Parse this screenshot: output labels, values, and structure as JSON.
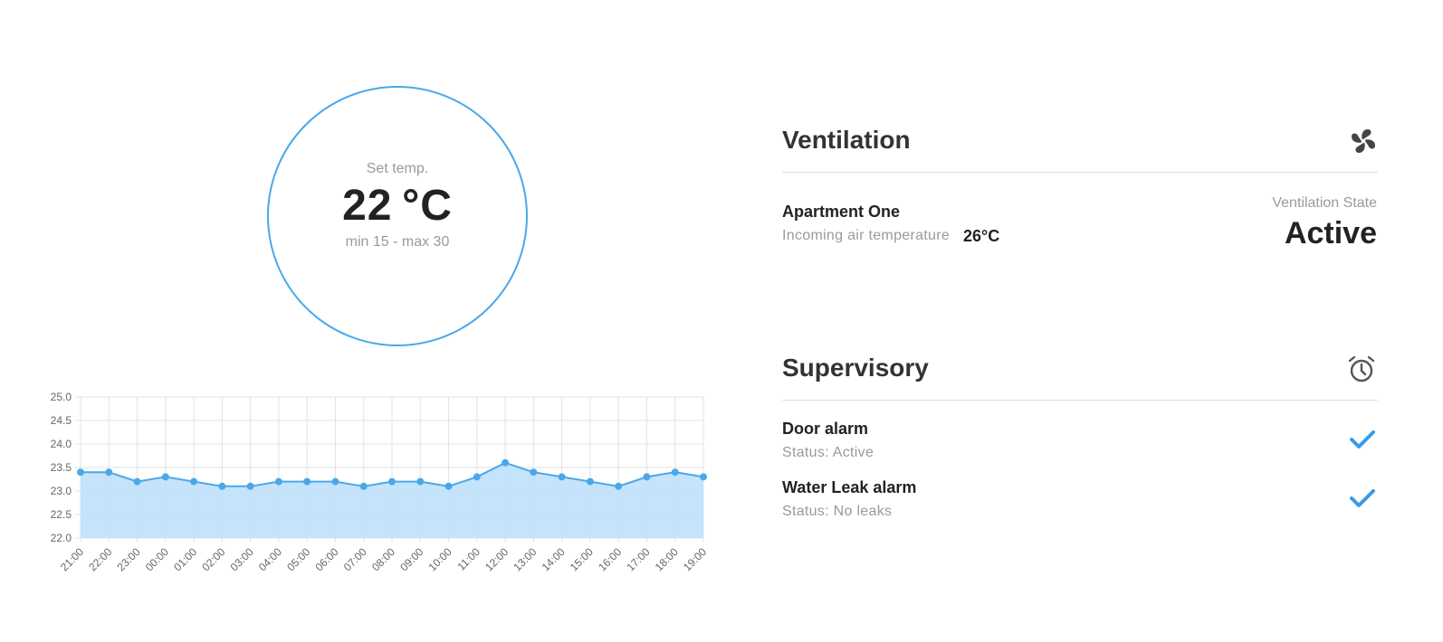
{
  "thermostat": {
    "label": "Set temp.",
    "value": "22 °C",
    "range": "min 15 - max 30",
    "accent": "#4aa8ea"
  },
  "chart_data": {
    "type": "area",
    "categories": [
      "21:00",
      "22:00",
      "23:00",
      "00:00",
      "01:00",
      "02:00",
      "03:00",
      "04:00",
      "05:00",
      "06:00",
      "07:00",
      "08:00",
      "09:00",
      "10:00",
      "11:00",
      "12:00",
      "13:00",
      "14:00",
      "15:00",
      "16:00",
      "17:00",
      "18:00",
      "19:00"
    ],
    "values": [
      23.4,
      23.4,
      23.2,
      23.3,
      23.2,
      23.1,
      23.1,
      23.2,
      23.2,
      23.2,
      23.1,
      23.2,
      23.2,
      23.1,
      23.3,
      23.6,
      23.4,
      23.3,
      23.2,
      23.1,
      23.3,
      23.4,
      23.3
    ],
    "ylim": [
      22.0,
      25.0
    ],
    "yticks": [
      "25.0",
      "24.5",
      "24.0",
      "23.5",
      "23.0",
      "22.5",
      "22.0"
    ],
    "grid": true,
    "line_color": "#4aa8ea",
    "fill_color": "#c2e2fa"
  },
  "ventilation": {
    "title": "Ventilation",
    "icon": "fan-icon",
    "apartment": "Apartment One",
    "incoming_label": "Incoming air temperature",
    "incoming_value": "26°C",
    "state_label": "Ventilation State",
    "state_value": "Active"
  },
  "supervisory": {
    "title": "Supervisory",
    "icon": "alarm-clock-icon",
    "alarms": [
      {
        "name": "Door alarm",
        "status": "Status: Active",
        "icon": "check-icon"
      },
      {
        "name": "Water Leak alarm",
        "status": "Status: No leaks",
        "icon": "check-icon"
      }
    ]
  }
}
